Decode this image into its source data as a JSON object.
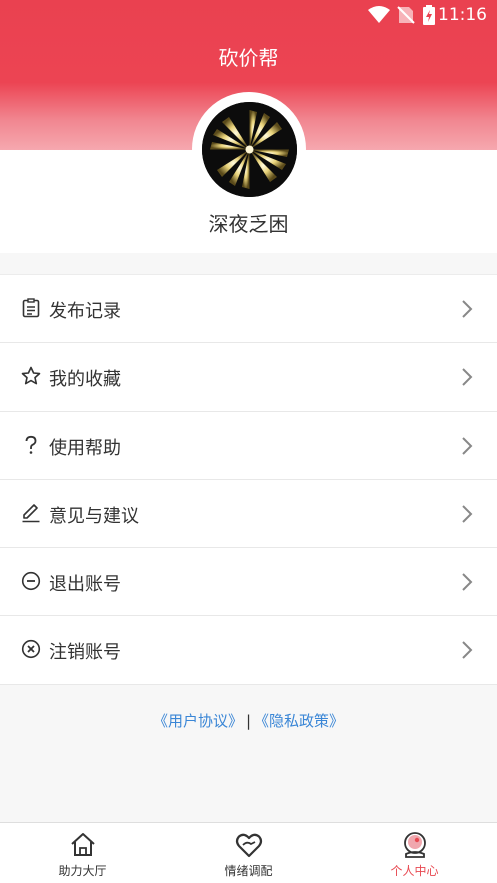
{
  "status": {
    "time": "11:16"
  },
  "header": {
    "title": "砍价帮"
  },
  "profile": {
    "nickname": "深夜乏困"
  },
  "menu": [
    {
      "label": "发布记录",
      "icon": "clipboard-icon"
    },
    {
      "label": "我的收藏",
      "icon": "star-icon"
    },
    {
      "label": "使用帮助",
      "icon": "question-icon"
    },
    {
      "label": "意见与建议",
      "icon": "pencil-icon"
    },
    {
      "label": "退出账号",
      "icon": "minus-circle-icon"
    },
    {
      "label": "注销账号",
      "icon": "x-circle-icon"
    }
  ],
  "links": {
    "agreement": "《用户协议》",
    "separator": "|",
    "privacy": "《隐私政策》"
  },
  "tabs": [
    {
      "label": "助力大厅",
      "icon": "home-icon"
    },
    {
      "label": "情绪调配",
      "icon": "heart-hands-icon"
    },
    {
      "label": "个人中心",
      "icon": "person-icon"
    }
  ],
  "colors": {
    "accent": "#ea4150",
    "link": "#3a86d6",
    "active_tab": "#e84a52"
  }
}
